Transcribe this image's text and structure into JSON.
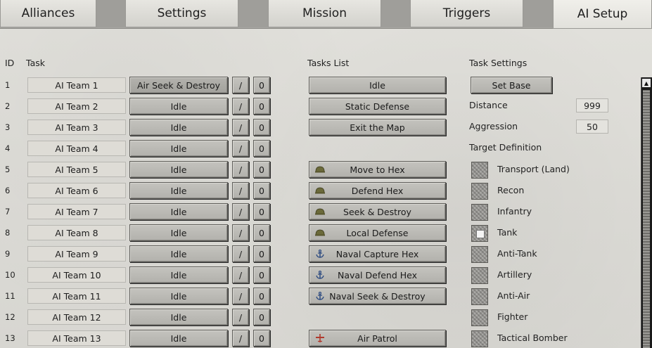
{
  "tabs": [
    {
      "label": "Alliances"
    },
    {
      "label": "Settings"
    },
    {
      "label": "Mission"
    },
    {
      "label": "Triggers"
    },
    {
      "label": "AI Setup"
    }
  ],
  "headers": {
    "id": "ID",
    "task": "Task",
    "tasks_list": "Tasks List",
    "task_settings": "Task Settings"
  },
  "rows": [
    {
      "id": "1",
      "team": "AI Team 1",
      "task": "Air Seek & Destroy",
      "slash": "/",
      "zero": "0"
    },
    {
      "id": "2",
      "team": "AI Team 2",
      "task": "Idle",
      "slash": "/",
      "zero": "0"
    },
    {
      "id": "3",
      "team": "AI Team 3",
      "task": "Idle",
      "slash": "/",
      "zero": "0"
    },
    {
      "id": "4",
      "team": "AI Team 4",
      "task": "Idle",
      "slash": "/",
      "zero": "0"
    },
    {
      "id": "5",
      "team": "AI Team 5",
      "task": "Idle",
      "slash": "/",
      "zero": "0"
    },
    {
      "id": "6",
      "team": "AI Team 6",
      "task": "Idle",
      "slash": "/",
      "zero": "0"
    },
    {
      "id": "7",
      "team": "AI Team 7",
      "task": "Idle",
      "slash": "/",
      "zero": "0"
    },
    {
      "id": "8",
      "team": "AI Team 8",
      "task": "Idle",
      "slash": "/",
      "zero": "0"
    },
    {
      "id": "9",
      "team": "AI Team 9",
      "task": "Idle",
      "slash": "/",
      "zero": "0"
    },
    {
      "id": "10",
      "team": "AI Team 10",
      "task": "Idle",
      "slash": "/",
      "zero": "0"
    },
    {
      "id": "11",
      "team": "AI Team 11",
      "task": "Idle",
      "slash": "/",
      "zero": "0"
    },
    {
      "id": "12",
      "team": "AI Team 12",
      "task": "Idle",
      "slash": "/",
      "zero": "0"
    },
    {
      "id": "13",
      "team": "AI Team 13",
      "task": "Idle",
      "slash": "/",
      "zero": "0"
    }
  ],
  "tasks_list": [
    {
      "label": "Idle",
      "icon": ""
    },
    {
      "label": "Static Defense",
      "icon": ""
    },
    {
      "label": "Exit the Map",
      "icon": ""
    },
    {
      "label": "Move to Hex",
      "icon": "helmet-icon"
    },
    {
      "label": "Defend Hex",
      "icon": "helmet-icon"
    },
    {
      "label": "Seek & Destroy",
      "icon": "helmet-icon"
    },
    {
      "label": "Local Defense",
      "icon": "helmet-icon"
    },
    {
      "label": "Naval Capture Hex",
      "icon": "anchor-icon"
    },
    {
      "label": "Naval Defend Hex",
      "icon": "anchor-icon"
    },
    {
      "label": "Naval Seek & Destroy",
      "icon": "anchor-icon"
    },
    {
      "label": "Air Patrol",
      "icon": "plane-icon"
    }
  ],
  "task_settings": {
    "set_base_label": "Set Base",
    "distance_label": "Distance",
    "distance_value": "999",
    "aggression_label": "Aggression",
    "aggression_value": "50",
    "target_definition_label": "Target Definition",
    "targets": [
      {
        "label": "Transport (Land)",
        "checked": false
      },
      {
        "label": "Recon",
        "checked": false
      },
      {
        "label": "Infantry",
        "checked": false
      },
      {
        "label": "Tank",
        "checked": true
      },
      {
        "label": "Anti-Tank",
        "checked": false
      },
      {
        "label": "Artillery",
        "checked": false
      },
      {
        "label": "Anti-Air",
        "checked": false
      },
      {
        "label": "Fighter",
        "checked": false
      },
      {
        "label": "Tactical Bomber",
        "checked": false
      }
    ]
  },
  "colors": {
    "helmet": "#6b6a3a",
    "anchor": "#2c4a80",
    "plane": "#b03a2e"
  }
}
